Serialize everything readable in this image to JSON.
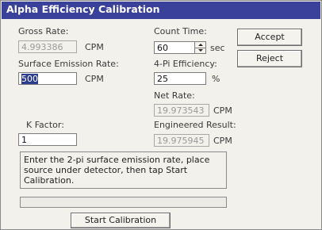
{
  "window": {
    "title": "Alpha Efficiency Calibration"
  },
  "gross_rate": {
    "label": "Gross Rate:",
    "value": "4.993386",
    "unit": "CPM"
  },
  "count_time": {
    "label": "Count Time:",
    "value": "60",
    "unit": "sec"
  },
  "surface_emission": {
    "label": "Surface Emission Rate:",
    "value": "500",
    "unit": "CPM"
  },
  "efficiency": {
    "label": "4-Pi Efficiency:",
    "value": "25",
    "unit": "%"
  },
  "net_rate": {
    "label": "Net Rate:",
    "value": "19.973543",
    "unit": "CPM"
  },
  "k_factor": {
    "label": "K Factor:",
    "value": "1"
  },
  "engineered_result": {
    "label": "Engineered Result:",
    "value": "19.975945",
    "unit": "CPM"
  },
  "buttons": {
    "accept": "Accept",
    "reject": "Reject",
    "start": "Start Calibration"
  },
  "message": "Enter the 2-pi surface emission rate, place source under detector, then tap Start Calibration.",
  "progress": {
    "fraction": 0
  },
  "colors": {
    "titlebar": "#3a419a",
    "selection": "#2c3d8e"
  },
  "icons": {
    "spin_up": "spin-up-arrow-icon",
    "spin_down": "spin-down-arrow-icon"
  }
}
